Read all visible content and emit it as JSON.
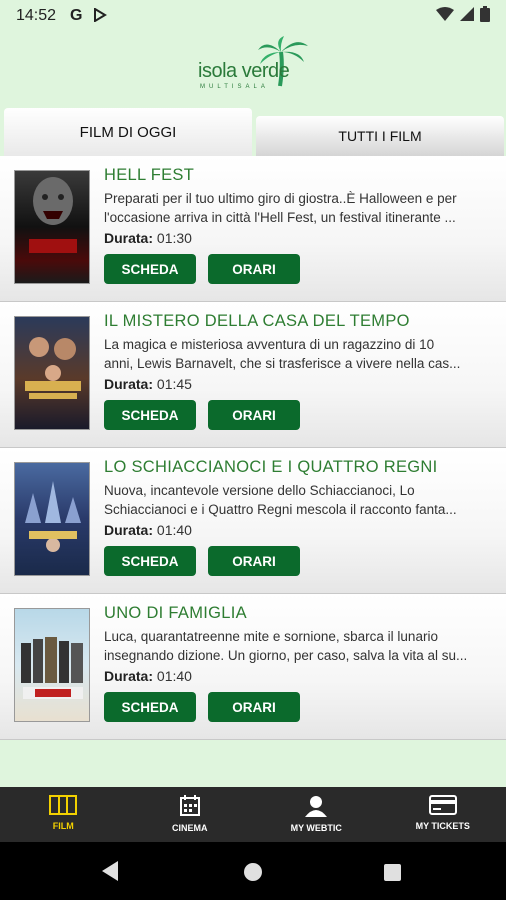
{
  "status": {
    "time": "14:52",
    "g_icon": "G"
  },
  "logo": {
    "name": "isola verde",
    "sub": "MULTISALA"
  },
  "tabs": [
    {
      "label": "FILM DI OGGI",
      "active": true
    },
    {
      "label": "TUTTI I FILM",
      "active": false
    }
  ],
  "films": [
    {
      "title": "HELL FEST",
      "desc1": "Preparati per il tuo ultimo giro di giostra..È Halloween e per",
      "desc2": "l'occasione arriva in città l'Hell Fest, un festival itinerante ...",
      "duration_label": "Durata:",
      "duration": "01:30",
      "scheda": "SCHEDA",
      "orari": "ORARI"
    },
    {
      "title": "IL MISTERO DELLA CASA DEL TEMPO",
      "desc1": "La magica e misteriosa avventura di un ragazzino di 10",
      "desc2": "anni, Lewis Barnavelt, che si trasferisce a vivere nella cas...",
      "duration_label": "Durata:",
      "duration": "01:45",
      "scheda": "SCHEDA",
      "orari": "ORARI"
    },
    {
      "title": "LO SCHIACCIANOCI E I QUATTRO REGNI",
      "desc1": "Nuova, incantevole versione dello Schiaccianoci, Lo",
      "desc2": "Schiaccianoci e i Quattro Regni mescola il racconto fanta...",
      "duration_label": "Durata:",
      "duration": "01:40",
      "scheda": "SCHEDA",
      "orari": "ORARI"
    },
    {
      "title": "UNO DI FAMIGLIA",
      "desc1": "Luca, quarantatreenne mite e sornione, sbarca il lunario",
      "desc2": "insegnando dizione. Un giorno, per caso, salva la vita al su...",
      "duration_label": "Durata:",
      "duration": "01:40",
      "scheda": "SCHEDA",
      "orari": "ORARI"
    }
  ],
  "nav": [
    {
      "label": "FILM",
      "icon": "film-icon",
      "active": true
    },
    {
      "label": "CINEMA",
      "icon": "calendar-icon",
      "active": false
    },
    {
      "label": "MY WEBTIC",
      "icon": "user-icon",
      "active": false
    },
    {
      "label": "MY TICKETS",
      "icon": "ticket-card-icon",
      "active": false
    }
  ],
  "colors": {
    "accent": "#0b6a2c",
    "title_green": "#2e7d32",
    "background": "#dff5dd",
    "nav_active": "#f2d000"
  }
}
